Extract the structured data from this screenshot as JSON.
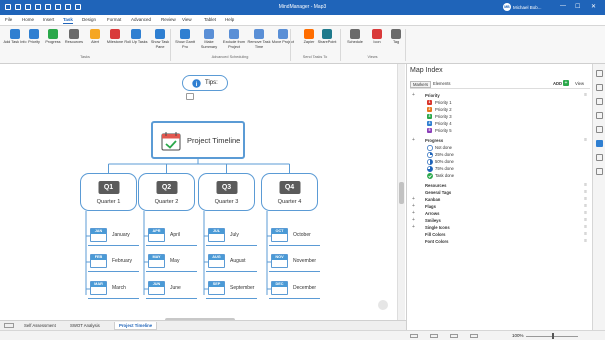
{
  "window": {
    "title": "MindManager - Map3",
    "user_name": "Michael Bob...",
    "user_initials": "MB",
    "minimize_glyph": "—",
    "maximize_glyph": "☐",
    "close_glyph": "✕"
  },
  "menu": [
    "File",
    "Home",
    "Insert",
    "Task",
    "Design",
    "Format",
    "Advanced",
    "Review",
    "View",
    "Tablet",
    "Help"
  ],
  "active_menu": "Task",
  "ribbon": {
    "buttons": [
      {
        "label": "Add Task Info",
        "icon": "add-task-info-icon",
        "color": "#2f7fd1"
      },
      {
        "label": "Priority",
        "icon": "priority-icon",
        "color": "#2f7fd1"
      },
      {
        "label": "Progress",
        "icon": "progress-icon",
        "color": "#2aa84a"
      },
      {
        "label": "Resources",
        "icon": "resources-icon",
        "color": "#6a6a6a"
      },
      {
        "label": "Alert",
        "icon": "alert-icon",
        "color": "#f5a623"
      },
      {
        "label": "Milestone",
        "icon": "milestone-icon",
        "color": "#d93a3a"
      },
      {
        "label": "Roll Up Tasks",
        "icon": "roll-up-icon",
        "color": "#2f7fd1"
      },
      {
        "label": "Show Task Pane",
        "icon": "task-pane-icon",
        "color": "#2f7fd1"
      },
      {
        "label": "Show Gantt Pro",
        "icon": "gantt-icon",
        "color": "#2f7fd1"
      },
      {
        "label": "Make Summary",
        "icon": "summary-icon",
        "color": "#5a8fd6"
      },
      {
        "label": "Exclude from Project",
        "icon": "exclude-icon",
        "color": "#5a8fd6"
      },
      {
        "label": "Remove Task Time",
        "icon": "remove-time-icon",
        "color": "#5a8fd6"
      },
      {
        "label": "Move Project",
        "icon": "move-project-icon",
        "color": "#5a8fd6"
      },
      {
        "label": "Zapier",
        "icon": "zapier-icon",
        "color": "#ff6d00"
      },
      {
        "label": "SharePoint",
        "icon": "sharepoint-icon",
        "color": "#1f7a8c"
      },
      {
        "label": "Schedule",
        "icon": "schedule-icon",
        "color": "#6a6a6a"
      },
      {
        "label": "Icon",
        "icon": "icon-icon",
        "color": "#d93a3a"
      },
      {
        "label": "Tag",
        "icon": "tag-icon",
        "color": "#6a6a6a"
      }
    ],
    "groups": [
      "Tasks",
      "Advanced Scheduling",
      "Send Tasks To",
      "Views"
    ]
  },
  "map": {
    "tips_label": "Tips:",
    "center_title": "Project Timeline",
    "quarters": [
      {
        "code": "Q1",
        "label": "Quarter 1",
        "months": [
          {
            "abbr": "JAN",
            "name": "January"
          },
          {
            "abbr": "FEB",
            "name": "February"
          },
          {
            "abbr": "MAR",
            "name": "March"
          }
        ]
      },
      {
        "code": "Q2",
        "label": "Quarter 2",
        "months": [
          {
            "abbr": "APR",
            "name": "April"
          },
          {
            "abbr": "MAY",
            "name": "May"
          },
          {
            "abbr": "JUN",
            "name": "June"
          }
        ]
      },
      {
        "code": "Q3",
        "label": "Quarter 3",
        "months": [
          {
            "abbr": "JUL",
            "name": "July"
          },
          {
            "abbr": "AUG",
            "name": "August"
          },
          {
            "abbr": "SEP",
            "name": "September"
          }
        ]
      },
      {
        "code": "Q4",
        "label": "Quarter 4",
        "months": [
          {
            "abbr": "OCT",
            "name": "October"
          },
          {
            "abbr": "NOV",
            "name": "November"
          },
          {
            "abbr": "DEC",
            "name": "December"
          }
        ]
      }
    ],
    "accent": "#5b9bd5",
    "card_header_color": "#4a9ad6"
  },
  "tabs": [
    {
      "label": "Self Assessment",
      "active": false
    },
    {
      "label": "SWOT Analysis",
      "active": false
    },
    {
      "label": "Project Timeline",
      "active": true
    }
  ],
  "statusbar": {
    "zoom": "100%"
  },
  "map_index": {
    "title": "Map Index",
    "tabs": [
      "Markers",
      "Elements"
    ],
    "add_label": "ADD",
    "view_label": "View",
    "priority": {
      "label": "Priority",
      "items": [
        {
          "num": "1",
          "label": "Priority 1",
          "color": "#d9342b"
        },
        {
          "num": "2",
          "label": "Priority 2",
          "color": "#e8731c"
        },
        {
          "num": "3",
          "label": "Priority 3",
          "color": "#2aa84a"
        },
        {
          "num": "4",
          "label": "Priority 4",
          "color": "#2f7fd1"
        },
        {
          "num": "5",
          "label": "Priority 5",
          "color": "#8b3fb8"
        }
      ]
    },
    "progress": {
      "label": "Progress",
      "items": [
        {
          "label": "Not done",
          "fraction": 0
        },
        {
          "label": "25% done",
          "fraction": 0.25
        },
        {
          "label": "50% done",
          "fraction": 0.5
        },
        {
          "label": "75% done",
          "fraction": 0.75
        },
        {
          "label": "Task done",
          "fraction": 1
        }
      ]
    },
    "categories": [
      {
        "label": "Resources",
        "expandable": false
      },
      {
        "label": "General Tags",
        "expandable": false
      },
      {
        "label": "Kanban",
        "expandable": true
      },
      {
        "label": "Flags",
        "expandable": true
      },
      {
        "label": "Arrows",
        "expandable": true
      },
      {
        "label": "Smileys",
        "expandable": true
      },
      {
        "label": "Single Icons",
        "expandable": true
      },
      {
        "label": "Fill Colors",
        "expandable": false
      },
      {
        "label": "Font Colors",
        "expandable": false
      }
    ]
  }
}
